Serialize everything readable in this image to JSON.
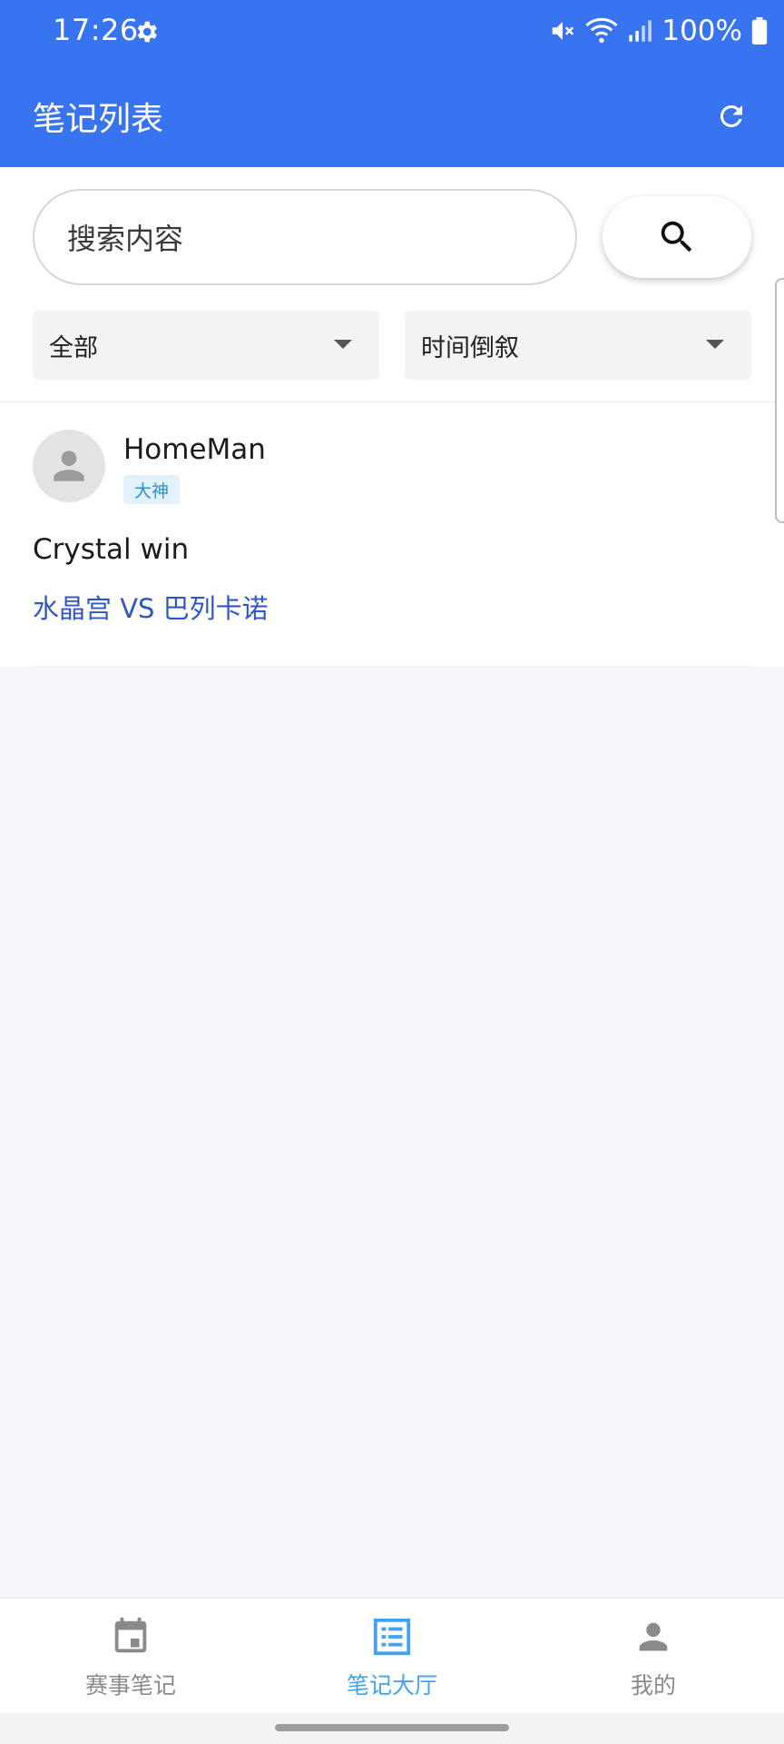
{
  "status_bar": {
    "time": "17:26",
    "battery": "100%"
  },
  "app_bar": {
    "title": "笔记列表"
  },
  "search": {
    "placeholder": "搜索内容"
  },
  "filters": {
    "category": "全部",
    "sort": "时间倒叙"
  },
  "notes": [
    {
      "author": "HomeMan",
      "badge": "大神",
      "title": "Crystal win",
      "match": "水晶宫 VS 巴列卡诺"
    }
  ],
  "bottom_nav": {
    "items": [
      {
        "label": "赛事笔记",
        "icon": "calendar-icon",
        "active": false
      },
      {
        "label": "笔记大厅",
        "icon": "list-icon",
        "active": true
      },
      {
        "label": "我的",
        "icon": "person-icon",
        "active": false
      }
    ]
  },
  "colors": {
    "primary": "#3873f0",
    "active_tab": "#43a3ee",
    "match_link": "#2f56c4",
    "badge_bg": "#e2f1fc",
    "badge_text": "#2a8fd6",
    "page_bg": "#f7f8fd"
  }
}
